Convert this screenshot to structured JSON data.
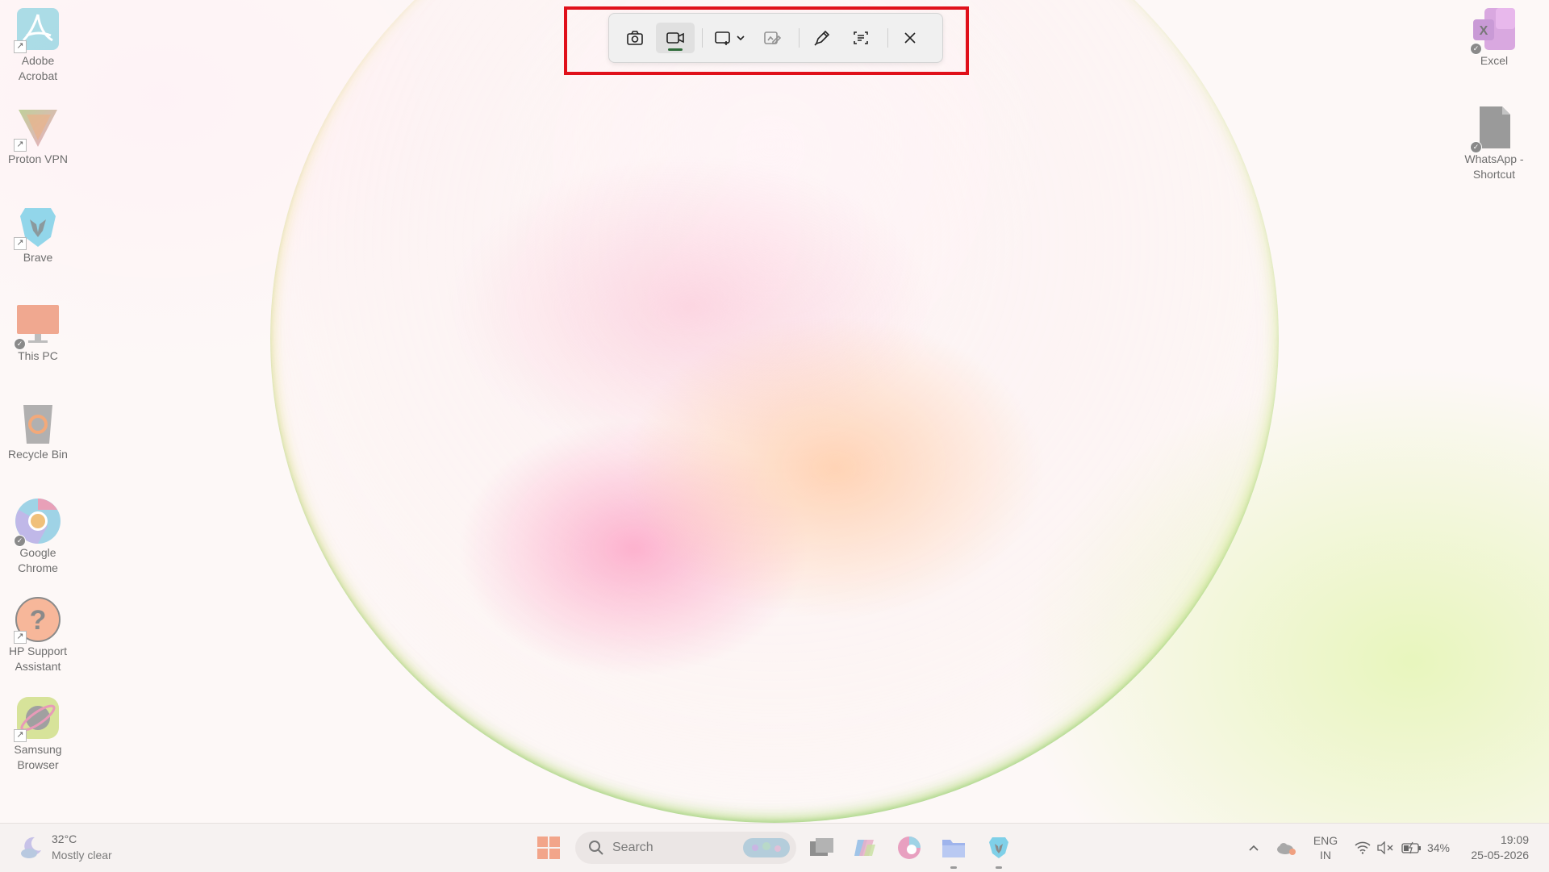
{
  "desktop": {
    "left_icons": [
      {
        "label_line1": "Adobe",
        "label_line2": "Acrobat",
        "icon": "adobe-acrobat-icon"
      },
      {
        "label_line1": "Proton VPN",
        "label_line2": "",
        "icon": "proton-vpn-icon"
      },
      {
        "label_line1": "Brave",
        "label_line2": "",
        "icon": "brave-icon"
      },
      {
        "label_line1": "This PC",
        "label_line2": "",
        "icon": "this-pc-icon"
      },
      {
        "label_line1": "Recycle Bin",
        "label_line2": "",
        "icon": "recycle-bin-icon"
      },
      {
        "label_line1": "Google",
        "label_line2": "Chrome",
        "icon": "google-chrome-icon"
      },
      {
        "label_line1": "HP Support",
        "label_line2": "Assistant",
        "icon": "hp-support-icon"
      },
      {
        "label_line1": "Samsung",
        "label_line2": "Browser",
        "icon": "samsung-browser-icon"
      }
    ],
    "right_icons": [
      {
        "label_line1": "Excel",
        "label_line2": "",
        "icon": "excel-icon"
      },
      {
        "label_line1": "WhatsApp -",
        "label_line2": "Shortcut",
        "icon": "whatsapp-shortcut-icon"
      }
    ]
  },
  "snipping_toolbar": {
    "buttons": [
      "camera-icon",
      "video-icon",
      "rectangle-mode-icon",
      "edit-image-icon",
      "pen-icon",
      "text-actions-icon",
      "close-icon"
    ],
    "active_mode": "video"
  },
  "taskbar": {
    "weather": {
      "temp": "32°C",
      "desc": "Mostly clear"
    },
    "search_placeholder": "Search",
    "tray": {
      "lang_line1": "ENG",
      "lang_line2": "IN",
      "battery": "34%",
      "time": "19:09",
      "date": "25-05-2026"
    }
  },
  "colors": {
    "highlight": "#e0101a",
    "active_indicator": "#2f6b3a"
  }
}
